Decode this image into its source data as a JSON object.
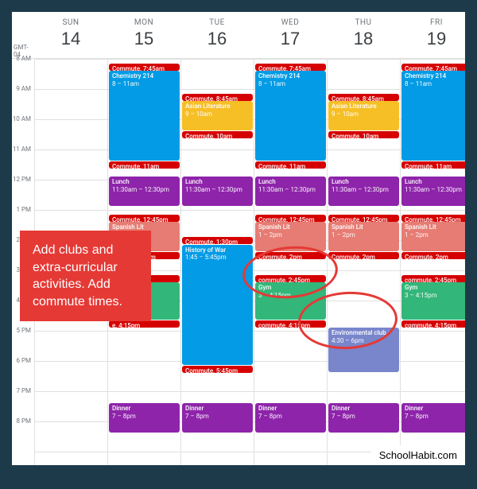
{
  "timezone": "GMT-04",
  "days": [
    {
      "name": "SUN",
      "num": "14"
    },
    {
      "name": "MON",
      "num": "15"
    },
    {
      "name": "TUE",
      "num": "16"
    },
    {
      "name": "WED",
      "num": "17"
    },
    {
      "name": "THU",
      "num": "18"
    },
    {
      "name": "FRI",
      "num": "19"
    }
  ],
  "hours": [
    "8 AM",
    "9 AM",
    "10 AM",
    "11 AM",
    "12 PM",
    "1 PM",
    "2 PM",
    "3 PM",
    "4 PM",
    "5 PM",
    "6 PM",
    "7 PM",
    "8 PM"
  ],
  "overlay": "Add clubs and extra-curricular activities. Add commute times.",
  "watermark": "SchoolHabit.com",
  "events": [
    {
      "day": 1,
      "s": 7.75,
      "e": 8,
      "c": "c-red",
      "t": "Commute, 7:45am"
    },
    {
      "day": 3,
      "s": 7.75,
      "e": 8,
      "c": "c-red",
      "t": "Commute, 7:45am"
    },
    {
      "day": 5,
      "s": 7.75,
      "e": 8,
      "c": "c-red",
      "t": "Commute, 7:45am"
    },
    {
      "day": 1,
      "s": 8,
      "e": 11,
      "c": "c-blue",
      "t": "Chemistry 214",
      "tm": "8 – 11am"
    },
    {
      "day": 3,
      "s": 8,
      "e": 11,
      "c": "c-blue",
      "t": "Chemistry 214",
      "tm": "8 – 11am"
    },
    {
      "day": 5,
      "s": 8,
      "e": 11,
      "c": "c-blue",
      "t": "Chemistry 214",
      "tm": "8 – 11am"
    },
    {
      "day": 2,
      "s": 8.75,
      "e": 9,
      "c": "c-red",
      "t": "Commute, 8:45am"
    },
    {
      "day": 4,
      "s": 8.75,
      "e": 9,
      "c": "c-red",
      "t": "Commute, 8:45am"
    },
    {
      "day": 2,
      "s": 9,
      "e": 10,
      "c": "c-yellow",
      "t": "Asian Literature",
      "tm": "9 – 10am"
    },
    {
      "day": 4,
      "s": 9,
      "e": 10,
      "c": "c-yellow",
      "t": "Asian Literature",
      "tm": "9 – 10am"
    },
    {
      "day": 2,
      "s": 10,
      "e": 10.25,
      "c": "c-red",
      "t": "Commute, 10am"
    },
    {
      "day": 4,
      "s": 10,
      "e": 10.25,
      "c": "c-red",
      "t": "Commute, 10am"
    },
    {
      "day": 1,
      "s": 11,
      "e": 11.25,
      "c": "c-red",
      "t": "Commute, 11am"
    },
    {
      "day": 3,
      "s": 11,
      "e": 11.25,
      "c": "c-red",
      "t": "Commute, 11am"
    },
    {
      "day": 5,
      "s": 11,
      "e": 11.25,
      "c": "c-red",
      "t": "Commute, 11am"
    },
    {
      "day": 1,
      "s": 11.5,
      "e": 12.5,
      "c": "c-purple",
      "t": "Lunch",
      "tm": "11:30am – 12:30pm"
    },
    {
      "day": 2,
      "s": 11.5,
      "e": 12.5,
      "c": "c-purple",
      "t": "Lunch",
      "tm": "11:30am – 12:30pm"
    },
    {
      "day": 3,
      "s": 11.5,
      "e": 12.5,
      "c": "c-purple",
      "t": "Lunch",
      "tm": "11:30am – 12:30pm"
    },
    {
      "day": 4,
      "s": 11.5,
      "e": 12.5,
      "c": "c-purple",
      "t": "Lunch",
      "tm": "11:30am – 12:30pm"
    },
    {
      "day": 5,
      "s": 11.5,
      "e": 12.5,
      "c": "c-purple",
      "t": "Lunch",
      "tm": "11:30am – 12:30pm"
    },
    {
      "day": 1,
      "s": 12.75,
      "e": 13,
      "c": "c-red",
      "t": "Commute, 12:45pm"
    },
    {
      "day": 3,
      "s": 12.75,
      "e": 13,
      "c": "c-red",
      "t": "Commute, 12:45pm"
    },
    {
      "day": 4,
      "s": 12.75,
      "e": 13,
      "c": "c-red",
      "t": "Commute, 12:45pm"
    },
    {
      "day": 5,
      "s": 12.75,
      "e": 13,
      "c": "c-red",
      "t": "Commute, 12:45pm"
    },
    {
      "day": 1,
      "s": 13,
      "e": 14,
      "c": "c-salmon",
      "t": "Spanish Lit",
      "tm": "1 – 2pm"
    },
    {
      "day": 3,
      "s": 13,
      "e": 14,
      "c": "c-salmon",
      "t": "Spanish Lit",
      "tm": "1 – 2pm"
    },
    {
      "day": 4,
      "s": 13,
      "e": 14,
      "c": "c-salmon",
      "t": "Spanish Lit",
      "tm": "1 – 2pm"
    },
    {
      "day": 5,
      "s": 13,
      "e": 14,
      "c": "c-salmon",
      "t": "Spanish Lit",
      "tm": "1 – 2pm"
    },
    {
      "day": 2,
      "s": 13.5,
      "e": 13.75,
      "c": "c-red",
      "t": "Commute, 1:30pm"
    },
    {
      "day": 2,
      "s": 13.75,
      "e": 17.75,
      "c": "c-blue",
      "t": "History of War",
      "tm": "1:45 – 5:45pm"
    },
    {
      "day": 1,
      "s": 14,
      "e": 14.25,
      "c": "c-red",
      "t": "Commute, 2pm"
    },
    {
      "day": 3,
      "s": 14,
      "e": 14.25,
      "c": "c-red",
      "t": "Commute, 2pm"
    },
    {
      "day": 4,
      "s": 14,
      "e": 14.25,
      "c": "c-red",
      "t": "Commute, 2pm"
    },
    {
      "day": 5,
      "s": 14,
      "e": 14.25,
      "c": "c-red",
      "t": "Commute, 2pm"
    },
    {
      "day": 1,
      "s": 14.75,
      "e": 15,
      "c": "c-red",
      "t": "ute, 2:45pm"
    },
    {
      "day": 3,
      "s": 14.75,
      "e": 15,
      "c": "c-red",
      "t": "commute, 2:45pm"
    },
    {
      "day": 5,
      "s": 14.75,
      "e": 15,
      "c": "c-red",
      "t": "commute, 2:45pm"
    },
    {
      "day": 1,
      "s": 15,
      "e": 16.25,
      "c": "c-green",
      "t": "",
      "tm": "15pm"
    },
    {
      "day": 3,
      "s": 15,
      "e": 16.25,
      "c": "c-green",
      "t": "Gym",
      "tm": "3 – 4:15pm"
    },
    {
      "day": 5,
      "s": 15,
      "e": 16.25,
      "c": "c-green",
      "t": "Gym",
      "tm": "3 – 4:15pm"
    },
    {
      "day": 1,
      "s": 16.25,
      "e": 16.5,
      "c": "c-red",
      "t": "e, 4:15pm"
    },
    {
      "day": 3,
      "s": 16.25,
      "e": 16.5,
      "c": "c-red",
      "t": "commute, 4:15pm"
    },
    {
      "day": 5,
      "s": 16.25,
      "e": 16.5,
      "c": "c-red",
      "t": "commute, 4:15pm"
    },
    {
      "day": 4,
      "s": 16.5,
      "e": 18,
      "c": "c-slate",
      "t": "Environmental club",
      "tm": "4:30 – 6pm"
    },
    {
      "day": 2,
      "s": 17.75,
      "e": 18,
      "c": "c-red",
      "t": "Commute, 5:45pm"
    },
    {
      "day": 1,
      "s": 19,
      "e": 20,
      "c": "c-purple",
      "t": "Dinner",
      "tm": "7 – 8pm"
    },
    {
      "day": 2,
      "s": 19,
      "e": 20,
      "c": "c-purple",
      "t": "Dinner",
      "tm": "7 – 8pm"
    },
    {
      "day": 3,
      "s": 19,
      "e": 20,
      "c": "c-purple",
      "t": "Dinner",
      "tm": "7 – 8pm"
    },
    {
      "day": 4,
      "s": 19,
      "e": 20,
      "c": "c-purple",
      "t": "Dinner",
      "tm": "7 – 8pm"
    },
    {
      "day": 5,
      "s": 19,
      "e": 20,
      "c": "c-purple",
      "t": "Dinner",
      "tm": "7 – 8pm"
    }
  ]
}
